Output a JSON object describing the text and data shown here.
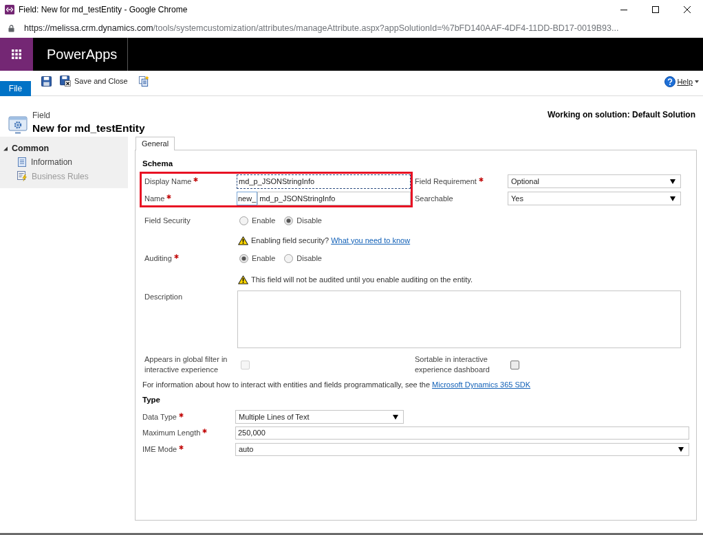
{
  "window": {
    "title": "Field: New for md_testEntity - Google Chrome"
  },
  "address_bar": {
    "url_host": "https://melissa.crm.dynamics.com",
    "url_path": "/tools/systemcustomization/attributes/manageAttribute.aspx?appSolutionId=%7bFD140AAF-4DF4-11DD-BD17-0019B93..."
  },
  "app_bar": {
    "title": "PowerApps"
  },
  "ribbon": {
    "file_tab": "File",
    "buttons": [
      {
        "kind": "save"
      },
      {
        "kind": "save_close",
        "label": "Save and Close"
      },
      {
        "kind": "publish"
      }
    ],
    "help": "Help"
  },
  "header": {
    "entity_type": "Field",
    "title": "New for md_testEntity",
    "solution": "Working on solution: Default Solution"
  },
  "nav": {
    "group": {
      "label": "Common",
      "expanded": true,
      "items": [
        {
          "kind": "information",
          "label": "Information",
          "disabled": false
        },
        {
          "kind": "rules",
          "label": "Business Rules",
          "disabled": true
        }
      ]
    }
  },
  "tabs": [
    {
      "label": "General",
      "selected": true
    }
  ],
  "schema": {
    "title": "Schema",
    "highlight": true,
    "display_name": {
      "label": "Display Name",
      "required": true,
      "value": "md_p_JSONStringInfo",
      "focused": true
    },
    "name": {
      "label": "Name",
      "required": true,
      "prefix": "new_",
      "value": "md_p_JSONStringInfo"
    },
    "field_requirement": {
      "label": "Field Requirement",
      "required": true,
      "value": "Optional"
    },
    "searchable": {
      "label": "Searchable",
      "required": false,
      "value": "Yes"
    },
    "field_security": {
      "label": "Field Security",
      "required": false,
      "options": [
        {
          "label": "Enable",
          "selected": false
        },
        {
          "label": "Disable",
          "selected": true
        }
      ],
      "warning": {
        "text": "Enabling field security?",
        "link": "What you need to know"
      }
    },
    "auditing": {
      "label": "Auditing",
      "required": true,
      "options": [
        {
          "label": "Enable",
          "selected": true
        },
        {
          "label": "Disable",
          "selected": false
        }
      ],
      "warning": {
        "text": "This field will not be audited until you enable auditing on the entity."
      }
    },
    "description": {
      "label": "Description",
      "required": false
    },
    "global_filter": {
      "label": "Appears in global filter in interactive experience",
      "checked": false,
      "disabled": true
    },
    "sortable": {
      "label": "Sortable in interactive experience dashboard",
      "checked": false,
      "disabled": false
    },
    "sdk_note": {
      "text": "For information about how to interact with entities and fields programmatically, see the",
      "link": "Microsoft Dynamics 365 SDK"
    }
  },
  "type_section": {
    "title": "Type",
    "data_type": {
      "label": "Data Type",
      "required": true,
      "value": "Multiple Lines of Text"
    },
    "max_length": {
      "label": "Maximum Length",
      "required": true,
      "value": "250,000"
    },
    "ime_mode": {
      "label": "IME Mode",
      "required": true,
      "value": "auto"
    }
  }
}
